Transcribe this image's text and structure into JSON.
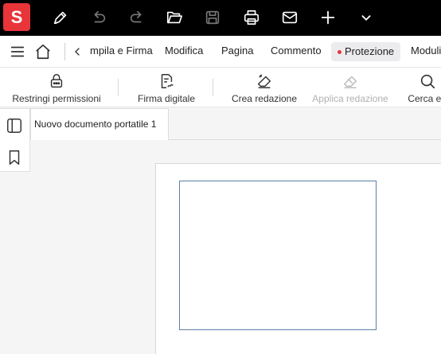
{
  "app": {
    "logo_letter": "S"
  },
  "titlebar": {
    "icons": [
      "pen-icon",
      "undo-icon",
      "redo-icon",
      "open-folder-icon",
      "save-icon",
      "print-icon",
      "mail-icon",
      "plus-icon",
      "chevron-down-icon"
    ]
  },
  "menubar": {
    "items": [
      {
        "label": "mpila e Firma"
      },
      {
        "label": "Modifica"
      },
      {
        "label": "Pagina"
      },
      {
        "label": "Commento"
      },
      {
        "label": "Protezione",
        "active": true
      },
      {
        "label": "Moduli"
      }
    ]
  },
  "ribbon": {
    "tools": [
      {
        "label": "Restringi permissioni",
        "icon": "lock-icon",
        "enabled": true
      },
      {
        "label": "Firma digitale",
        "icon": "signature-icon",
        "enabled": true
      },
      {
        "label": "Crea redazione",
        "icon": "redact-icon",
        "enabled": true
      },
      {
        "label": "Applica redazione",
        "icon": "apply-redact-icon",
        "enabled": false
      },
      {
        "label": "Cerca e r",
        "icon": "search-icon",
        "enabled": true
      }
    ]
  },
  "tabs": [
    {
      "label": "Nuovo documento portatile 1"
    }
  ],
  "colors": {
    "brand": "#e8353a",
    "titlebar": "#000000",
    "field_border": "#5b7fa8"
  }
}
